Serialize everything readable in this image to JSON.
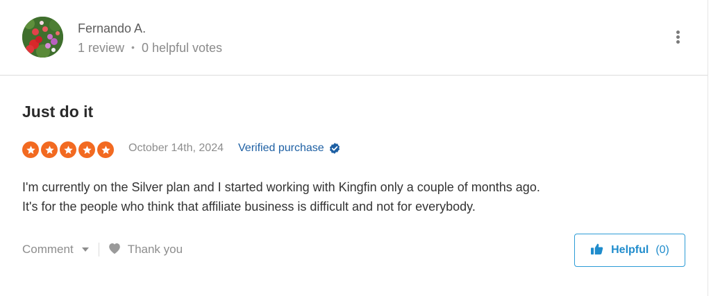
{
  "reviewer": {
    "name": "Fernando A.",
    "reviews": "1 review",
    "separator": "•",
    "helpful_votes": "0 helpful votes"
  },
  "review": {
    "title": "Just do it",
    "rating": 5,
    "date": "October 14th, 2024",
    "verified_label": "Verified purchase",
    "body": [
      "I'm currently on the Silver plan and I started working with Kingfin only a couple of months ago.",
      "It's for the people who think that affiliate business is difficult and not for everybody."
    ]
  },
  "actions": {
    "comment_label": "Comment",
    "thank_label": "Thank you",
    "helpful_label": "Helpful",
    "helpful_count": "(0)"
  },
  "icons": {
    "avatar": "flower-photo-avatar",
    "more": "more-vertical-icon",
    "star": "star-icon",
    "verified": "check-badge-icon",
    "comment_caret": "chevron-down-icon",
    "heart": "heart-icon",
    "thumb": "thumbs-up-icon"
  },
  "colors": {
    "star": "#f26a21",
    "verified": "#1d5fa3",
    "helpful_accent": "#1f8ccc",
    "text_primary": "#333333",
    "text_muted": "#8d8d8d"
  }
}
